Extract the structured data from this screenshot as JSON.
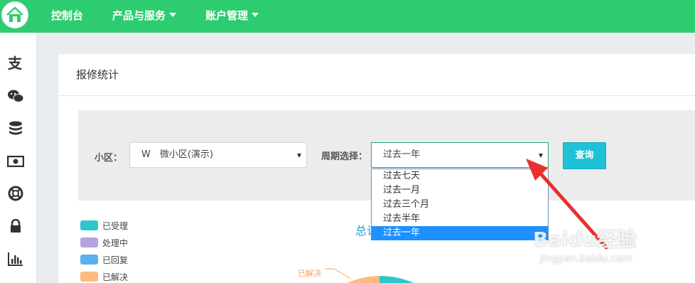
{
  "nav": {
    "items": [
      {
        "label": "控制台",
        "dropdown": false
      },
      {
        "label": "产品与服务",
        "dropdown": true
      },
      {
        "label": "账户管理",
        "dropdown": true
      }
    ]
  },
  "sidebar": {
    "icons": [
      "alipay-icon",
      "wechat-icon",
      "database-icon",
      "money-icon",
      "lifebuoy-icon",
      "lock-icon",
      "bar-chart-icon"
    ]
  },
  "panel": {
    "title": "报修统计",
    "filters": {
      "community_label": "小区：",
      "community_value": "W　微小区(演示)",
      "period_label": "周期选择：",
      "period_value": "过去一年",
      "period_options": [
        "过去七天",
        "过去一月",
        "过去三个月",
        "过去半年",
        "过去一年"
      ],
      "selected_index": 4,
      "query_button": "查询"
    },
    "legend": [
      {
        "label": "已受理",
        "color": "#2ec7c9"
      },
      {
        "label": "处理中",
        "color": "#b6a2de"
      },
      {
        "label": "已回复",
        "color": "#5ab1ef"
      },
      {
        "label": "已解决",
        "color": "#ffb980"
      }
    ],
    "chart_title_partial": "总计",
    "pie_label": "已解决"
  },
  "watermark": {
    "main": "Baidu经验",
    "sub": "jingyan.baidu.com"
  },
  "colors": {
    "nav_bg": "#2ecc71",
    "accent": "#1ec1d6",
    "selected": "#1e90ff",
    "arrow": "#e8302e"
  }
}
